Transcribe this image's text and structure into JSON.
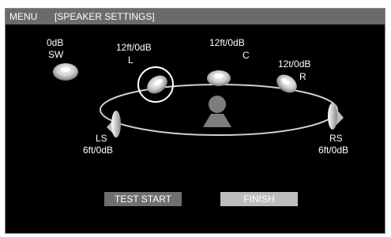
{
  "header": {
    "menu_label": "MENU",
    "section_title": "[SPEAKER SETTINGS]"
  },
  "speakers": {
    "sw": {
      "distance": "0dB",
      "name": "SW"
    },
    "l": {
      "distance": "12ft/0dB",
      "name": "L"
    },
    "c": {
      "distance": "12ft/0dB",
      "name": "C"
    },
    "r": {
      "distance": "12t/0dB",
      "name": "R"
    },
    "ls": {
      "name": "LS",
      "distance": "6ft/0dB"
    },
    "rs": {
      "name": "RS",
      "distance": "6ft/0dB"
    }
  },
  "buttons": {
    "test_start": "TEST START",
    "finish": "FINISH"
  },
  "colors": {
    "title_bar": "#6b6b6b",
    "background": "#000000",
    "selected_button": "#6f6f6f",
    "highlight_button": "#bdbdbd"
  },
  "icons": {
    "speaker": "speaker-icon",
    "listener": "listener-icon",
    "selection_ring": "selection-ring-icon"
  }
}
